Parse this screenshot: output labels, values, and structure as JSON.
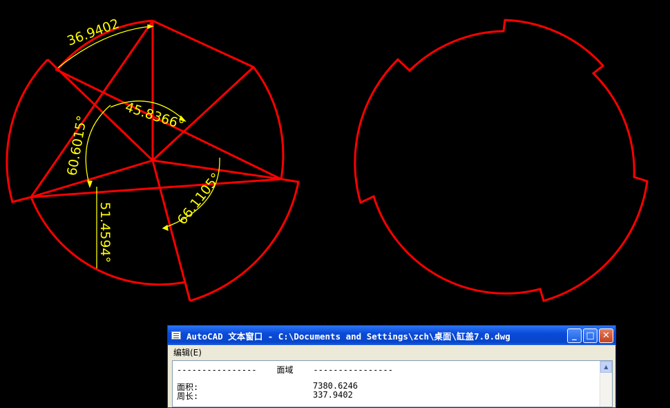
{
  "drawing": {
    "dimensions": {
      "linear": "36.9402",
      "angle_top": "45.8366°",
      "angle_left": "60.6015°",
      "angle_bottom_left": "51.4594°",
      "angle_right": "66.1105°"
    },
    "colors": {
      "geometry": "#ff0000",
      "dimension": "#ffff00",
      "background": "#000000"
    }
  },
  "text_window": {
    "title": "AutoCAD 文本窗口 - C:\\Documents and Settings\\zch\\桌面\\缸盖7.0.dwg",
    "menu_edit": "编辑(E)",
    "header_line": "----------------    面域    ----------------",
    "rows": [
      {
        "label": "面积:",
        "value": "7380.6246"
      },
      {
        "label": "周长:",
        "value": "337.9402"
      }
    ],
    "icons": [
      "window-icon",
      "minimize-icon",
      "maximize-icon",
      "close-icon",
      "scroll-up-arrow-icon"
    ]
  }
}
